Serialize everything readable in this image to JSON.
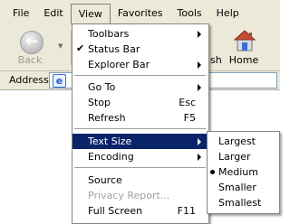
{
  "menubar": {
    "items": [
      {
        "label": "File"
      },
      {
        "label": "Edit"
      },
      {
        "label": "View"
      },
      {
        "label": "Favorites"
      },
      {
        "label": "Tools"
      },
      {
        "label": "Help"
      }
    ]
  },
  "toolbar": {
    "back_label": "Back",
    "back_state": "disabled",
    "partial_label": "sh",
    "home_label": "Home"
  },
  "address": {
    "label": "Address",
    "value": ""
  },
  "view_menu": {
    "items": [
      {
        "label": "Toolbars",
        "submenu": true
      },
      {
        "label": "Status Bar",
        "checked": true
      },
      {
        "label": "Explorer Bar",
        "submenu": true
      },
      {
        "label": "Go To",
        "submenu": true
      },
      {
        "label": "Stop",
        "shortcut": "Esc"
      },
      {
        "label": "Refresh",
        "shortcut": "F5"
      },
      {
        "label": "Text Size",
        "submenu": true,
        "highlighted": true
      },
      {
        "label": "Encoding",
        "submenu": true
      },
      {
        "label": "Source"
      },
      {
        "label": "Privacy Report...",
        "disabled": true
      },
      {
        "label": "Full Screen",
        "shortcut": "F11"
      }
    ]
  },
  "text_size_menu": {
    "items": [
      {
        "label": "Largest"
      },
      {
        "label": "Larger"
      },
      {
        "label": "Medium",
        "selected": true
      },
      {
        "label": "Smaller"
      },
      {
        "label": "Smallest"
      }
    ]
  },
  "colors": {
    "chrome": "#ece9d8",
    "highlight": "#0a246a",
    "disabled_text": "#a0a0a0"
  },
  "icons": {
    "back": "back-arrow-icon",
    "home": "home-icon",
    "address": "ie-page-icon"
  }
}
